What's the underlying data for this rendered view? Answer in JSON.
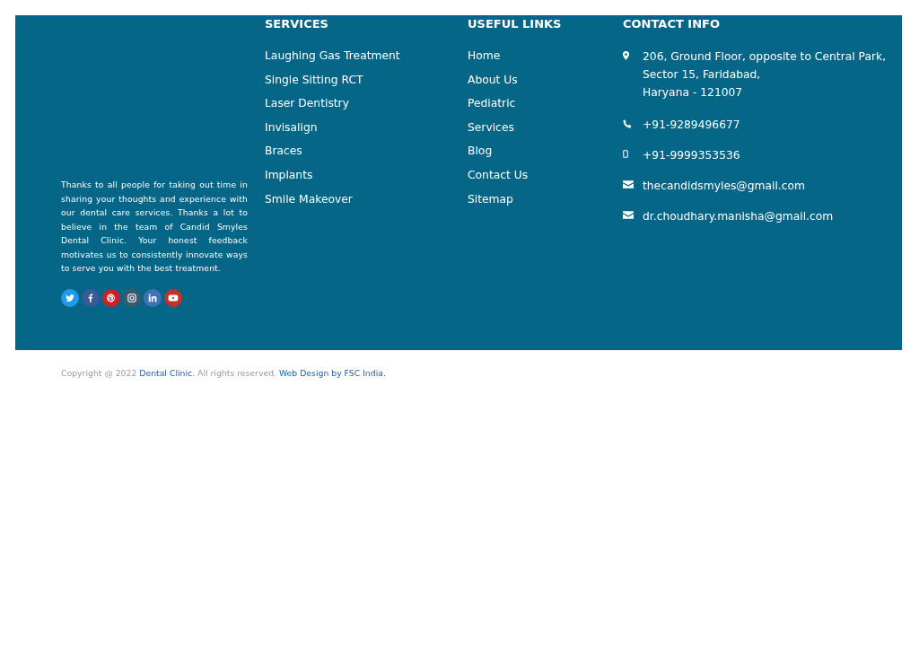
{
  "about": {
    "text": "Thanks to all people for taking out time in sharing your thoughts and experience with our dental care services. Thanks a lot to believe in the team of Candid Smyles Dental Clinic. Your honest feedback motivates us to consistently innovate ways to serve you with the best treatment."
  },
  "social": [
    {
      "kind": "twitter",
      "color": "#1f9be8"
    },
    {
      "kind": "facebook",
      "color": "#3b5998"
    },
    {
      "kind": "pinterest",
      "color": "#cb2027"
    },
    {
      "kind": "instagram",
      "color": "#3d5a6c"
    },
    {
      "kind": "linkedin",
      "color": "#3f72b5"
    },
    {
      "kind": "youtube",
      "color": "#c4302b"
    }
  ],
  "services": {
    "heading": "SERVICES",
    "items": [
      "Laughing Gas Treatment",
      "Single Sitting RCT",
      "Laser Dentistry",
      "Invisalign",
      "Braces",
      "Implants",
      "Smile Makeover"
    ]
  },
  "useful_links": {
    "heading": "USEFUL LINKS",
    "items": [
      "Home",
      "About Us",
      "Pediatric",
      "Services",
      "Blog",
      "Contact Us",
      "Sitemap"
    ]
  },
  "contact_info": {
    "heading": "CONTACT INFO",
    "items": [
      {
        "kind": "location",
        "lines": [
          "206, Ground Floor, opposite to Central Park,",
          "Sector 15, Faridabad,",
          "Haryana - 121007"
        ]
      },
      {
        "kind": "phone",
        "lines": [
          "+91-9289496677"
        ]
      },
      {
        "kind": "mobile",
        "lines": [
          "+91-9999353536"
        ]
      },
      {
        "kind": "email",
        "lines": [
          "thecandidsmyles@gmail.com"
        ]
      },
      {
        "kind": "email",
        "lines": [
          "dr.choudhary.manisha@gmail.com"
        ]
      }
    ]
  },
  "copyright": [
    {
      "kind": "text",
      "text": "Copyright @ 2022 "
    },
    {
      "kind": "link",
      "text": "Dental Clinic."
    },
    {
      "kind": "text",
      "text": " All rights reserved. "
    },
    {
      "kind": "link",
      "text": "Web Design by FSC India."
    }
  ]
}
